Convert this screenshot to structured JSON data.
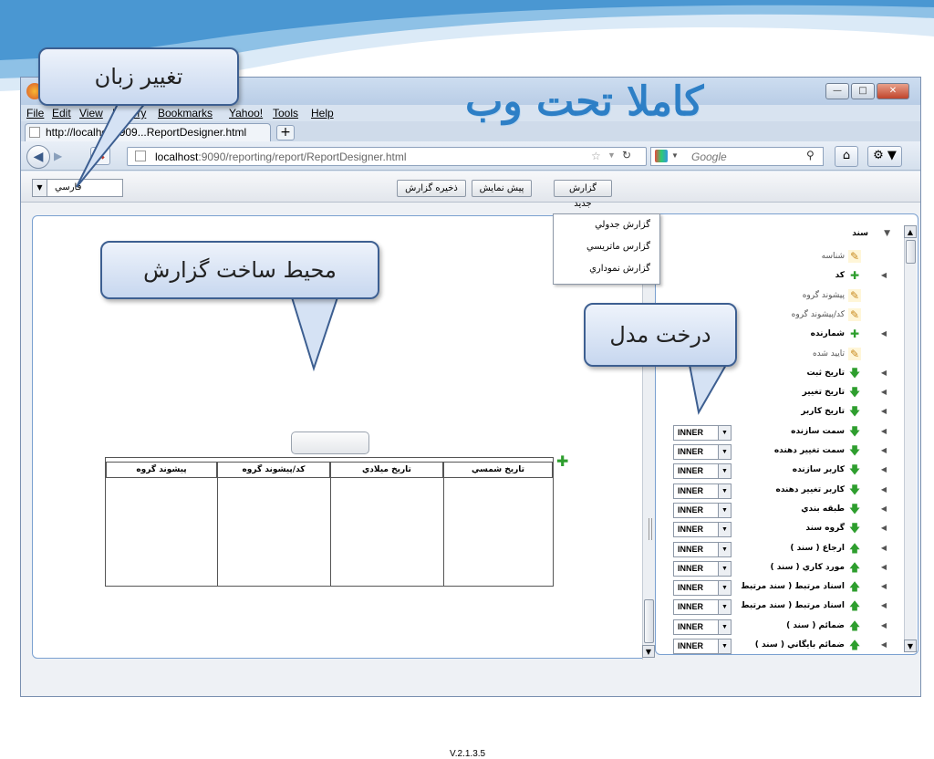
{
  "slide": {
    "headline": "کاملا تحت وب",
    "callouts": {
      "change_language": "تغییر زبان",
      "report_builder_env": "محیط ساخت گزارش",
      "model_tree": "درخت مدل"
    }
  },
  "browser": {
    "menu": [
      "File",
      "Edit",
      "View",
      "History",
      "Bookmarks",
      "Yahoo!",
      "Tools",
      "Help"
    ],
    "tab_title": "http://localhost:909...ReportDesigner.html",
    "url_host": "localhost",
    "url_rest": ":9090/reporting/report/ReportDesigner.html",
    "search_placeholder": "Google"
  },
  "app": {
    "language": "فارسي",
    "toolbar": {
      "new_report": "گزارش جديد",
      "preview": "پيش نمايش",
      "save_report": "ذخيره گزارش"
    },
    "new_report_menu": [
      "گزارش جدولي",
      "گزارس ماتريسي",
      "گزارش نموداري"
    ],
    "grid_columns": [
      "تاريخ شمسي",
      "تاريخ ميلادي",
      "كد/پيشوند گروه",
      "پيشوند گروه"
    ],
    "version": "V.2.1.3.5"
  },
  "tree": {
    "root": "سند",
    "items": [
      {
        "label": "شناسه",
        "icon": "edit-icon",
        "expand": false,
        "join": ""
      },
      {
        "label": "كد",
        "icon": "plus-icon",
        "expand": true,
        "join": ""
      },
      {
        "label": "پيشوند گروه",
        "icon": "edit-icon",
        "expand": false,
        "join": ""
      },
      {
        "label": "كد/پيشوند گروه",
        "icon": "edit-icon",
        "expand": false,
        "join": ""
      },
      {
        "label": "شمارنده",
        "icon": "plus-icon",
        "expand": true,
        "join": ""
      },
      {
        "label": "تاييد شده",
        "icon": "edit-icon",
        "expand": false,
        "join": ""
      },
      {
        "label": "تاريخ ثبت",
        "icon": "down-arrow-icon",
        "expand": true,
        "join": ""
      },
      {
        "label": "تاريخ تغيير",
        "icon": "down-arrow-icon",
        "expand": true,
        "join": ""
      },
      {
        "label": "تاريخ كاربر",
        "icon": "down-arrow-icon",
        "expand": true,
        "join": ""
      },
      {
        "label": "سمت سازنده",
        "icon": "down-arrow-icon",
        "expand": true,
        "join": "INNER"
      },
      {
        "label": "سمت تغيير دهنده",
        "icon": "down-arrow-icon",
        "expand": true,
        "join": "INNER"
      },
      {
        "label": "كاربر سازنده",
        "icon": "down-arrow-icon",
        "expand": true,
        "join": "INNER"
      },
      {
        "label": "كاربر تغيير دهنده",
        "icon": "down-arrow-icon",
        "expand": true,
        "join": "INNER"
      },
      {
        "label": "طبقه بندي",
        "icon": "down-arrow-icon",
        "expand": true,
        "join": "INNER"
      },
      {
        "label": "گروه سند",
        "icon": "down-arrow-icon",
        "expand": true,
        "join": "INNER"
      },
      {
        "label": "ارجاع ( سند )",
        "icon": "up-arrow-icon",
        "expand": true,
        "join": "INNER"
      },
      {
        "label": "مورد كاري ( سند )",
        "icon": "up-arrow-icon",
        "expand": true,
        "join": "INNER"
      },
      {
        "label": "اسناد مرتبط ( سند مرتبط",
        "icon": "up-arrow-icon",
        "expand": true,
        "join": "INNER"
      },
      {
        "label": "اسناد مرتبط ( سند مرتبط",
        "icon": "up-arrow-icon",
        "expand": true,
        "join": "INNER"
      },
      {
        "label": "ضمائم ( سند )",
        "icon": "up-arrow-icon",
        "expand": true,
        "join": "INNER"
      },
      {
        "label": "ضمائم بايگاني ( سند )",
        "icon": "up-arrow-icon",
        "expand": true,
        "join": "INNER"
      }
    ]
  }
}
